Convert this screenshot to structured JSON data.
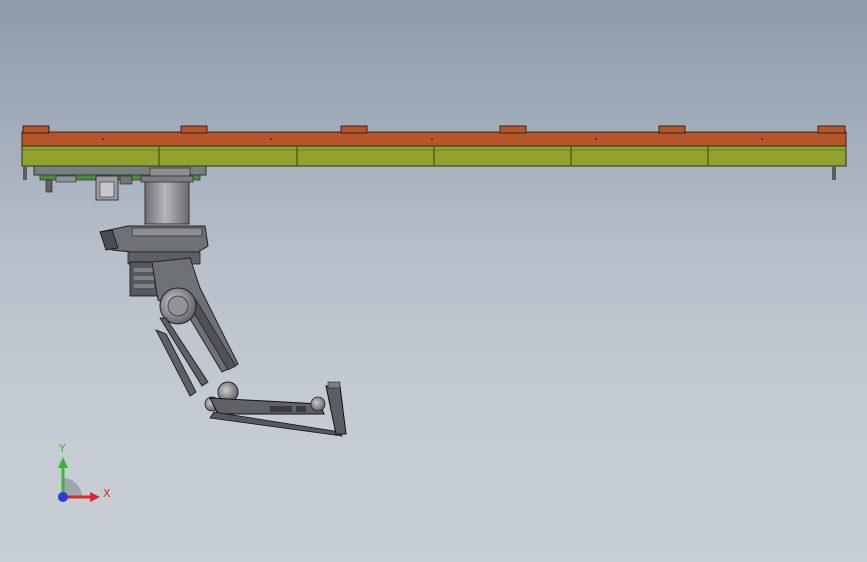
{
  "viewport": {
    "colors": {
      "background_top": "#8e9aab",
      "background_bottom": "#c9cfd6",
      "rail_top": "#b5552a",
      "rail_body": "#8fa32d",
      "robot_metal": "#6e7176",
      "robot_dark": "#4a4c50",
      "column": "#9a9a9c"
    }
  },
  "triad": {
    "y_label": "Y",
    "x_label": "X",
    "colors": {
      "y": "#3db43d",
      "x": "#e0262b",
      "z": "#2a3cd6"
    }
  }
}
